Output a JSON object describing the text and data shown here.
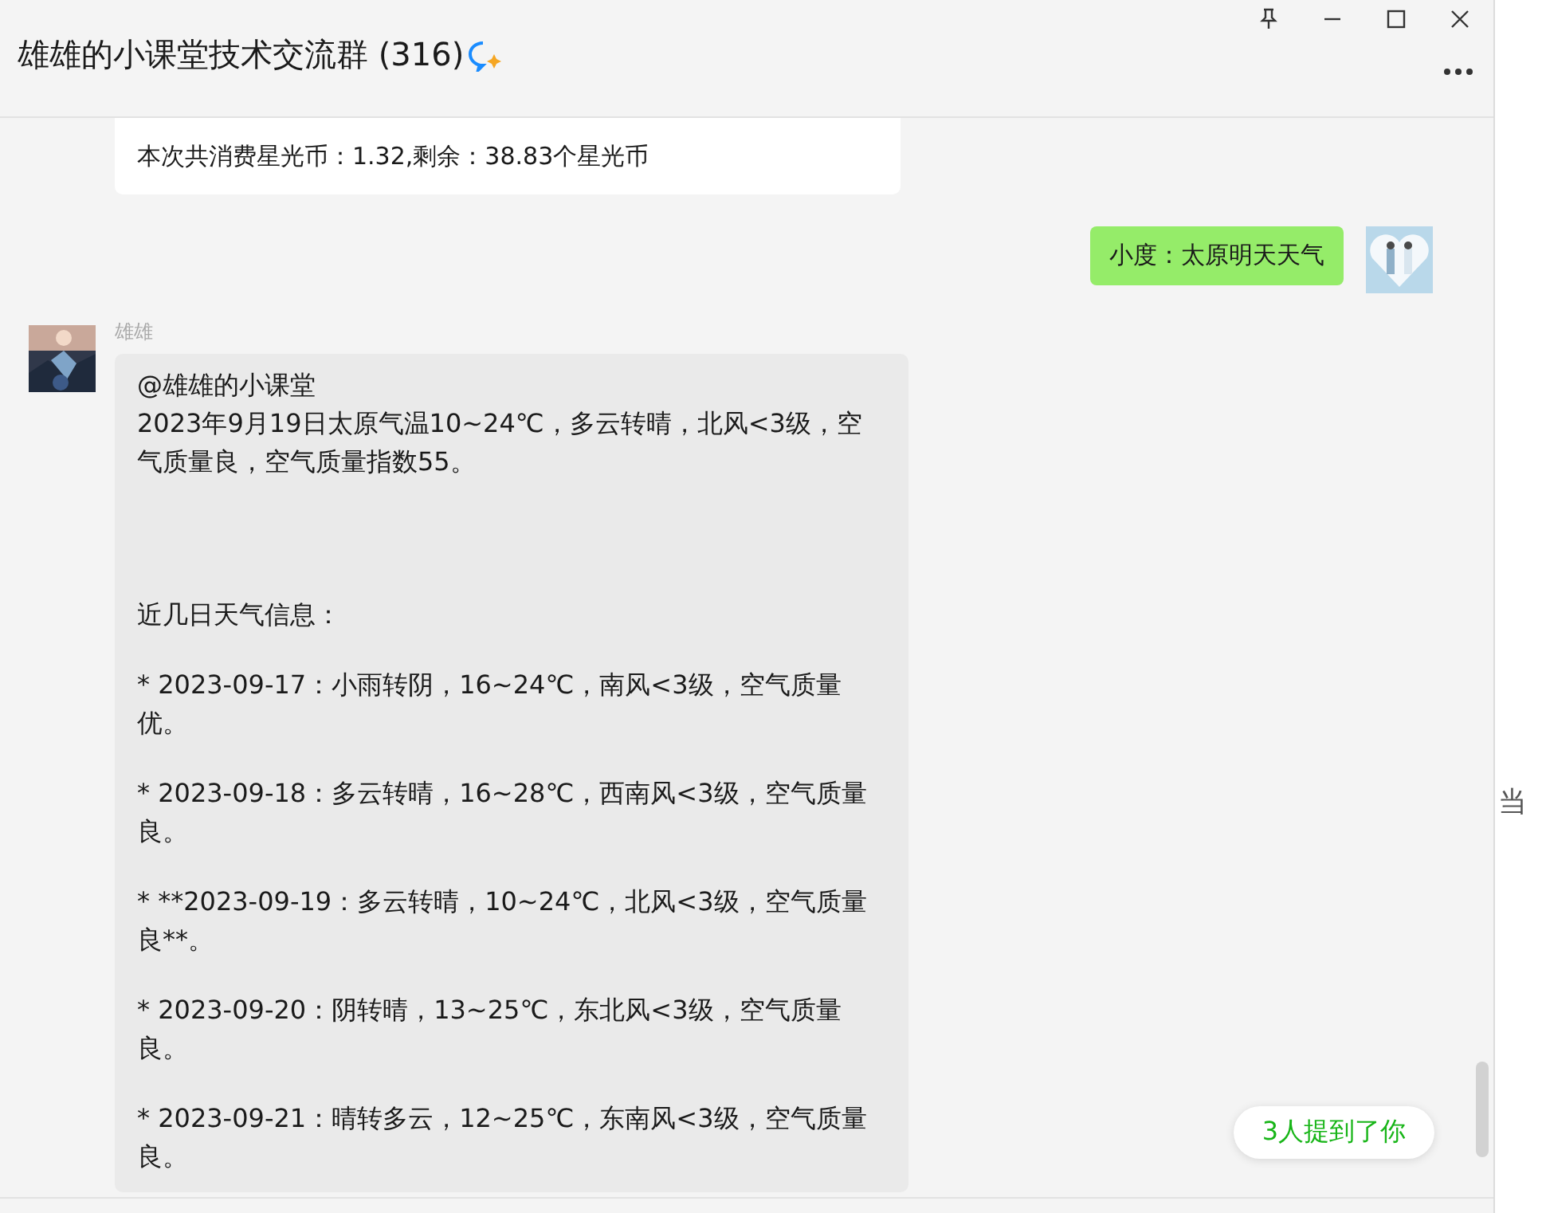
{
  "window": {
    "title": "雄雄的小课堂技术交流群 (316)"
  },
  "messages": [
    {
      "kind": "system_card",
      "text": "本次共消费星光币：1.32,剩余：38.83个星光币"
    },
    {
      "kind": "outgoing",
      "text": "小度：太原明天天气"
    },
    {
      "kind": "incoming",
      "sender": "雄雄",
      "mention": "@雄雄的小课堂",
      "summary": "2023年9月19日太原气温10~24℃，多云转晴，北风<3级，空气质量良，空气质量指数55。",
      "heading": "近几日天气信息：",
      "items": [
        "* 2023-09-17：小雨转阴，16~24℃，南风<3级，空气质量优。",
        "* 2023-09-18：多云转晴，16~28℃，西南风<3级，空气质量良。",
        "* **2023-09-19：多云转晴，10~24℃，北风<3级，空气质量良**。",
        "* 2023-09-20：阴转晴，13~25℃，东北风<3级，空气质量良。",
        "* 2023-09-21：晴转多云，12~25℃，东南风<3级，空气质量良。"
      ]
    }
  ],
  "mention_badge": "3人提到了你",
  "side_text": "当"
}
